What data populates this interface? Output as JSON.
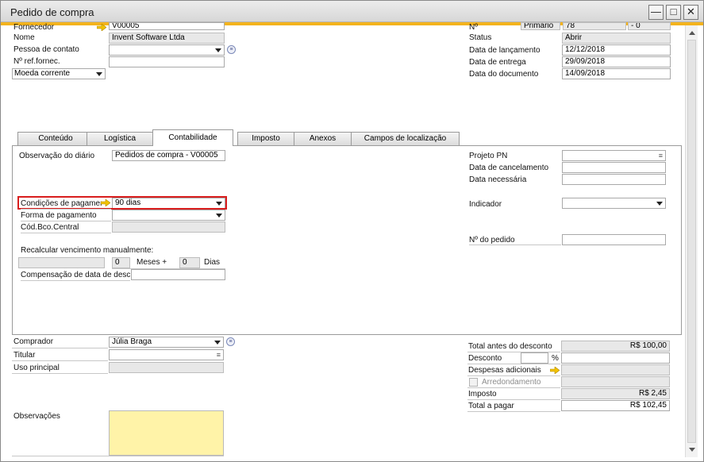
{
  "window": {
    "title": "Pedido de compra",
    "minimize_glyph": "—",
    "maximize_glyph": "□",
    "close_glyph": "✕"
  },
  "header_left": {
    "fornecedor_label": "Fornecedor",
    "fornecedor_value": "V00005",
    "nome_label": "Nome",
    "nome_value": "Invent Software Ltda",
    "pessoa_label": "Pessoa de contato",
    "pessoa_value": "",
    "ref_label": "Nº ref.fornec.",
    "ref_value": "",
    "moeda_label": "Moeda corrente"
  },
  "header_right": {
    "no_label": "Nº",
    "series_value": "Primário",
    "number_value": "78",
    "suffix_value": "0",
    "status_label": "Status",
    "status_value": "Abrir",
    "lanc_label": "Data de lançamento",
    "lanc_value": "12/12/2018",
    "entrega_label": "Data de entrega",
    "entrega_value": "29/09/2018",
    "doc_label": "Data do documento",
    "doc_value": "14/09/2018"
  },
  "tabs": [
    {
      "label": "Conteúdo"
    },
    {
      "label": "Logística"
    },
    {
      "label": "Contabilidade"
    },
    {
      "label": "Imposto"
    },
    {
      "label": "Anexos"
    },
    {
      "label": "Campos de localização"
    }
  ],
  "accounting": {
    "obs_diario_label": "Observação do diário",
    "obs_diario_value": "Pedidos de compra - V00005",
    "cond_pag_label": "Condições de pagamento",
    "cond_pag_value": "90 dias",
    "forma_pag_label": "Forma de pagamento",
    "forma_pag_value": "",
    "cod_bco_label": "Cód.Bco.Central",
    "recalc_label": "Recalcular vencimento manualmente:",
    "meses_value": "0",
    "meses_label": "Meses +",
    "dias_value": "0",
    "dias_label": "Dias",
    "comp_label": "Compensação de data de desconto",
    "projeto_label": "Projeto PN",
    "cancel_label": "Data de cancelamento",
    "necessaria_label": "Data necessária",
    "indicador_label": "Indicador",
    "pedido_label": "Nº do pedido"
  },
  "footer_left": {
    "comprador_label": "Comprador",
    "comprador_value": "Júlia Braga",
    "titular_label": "Titular",
    "uso_label": "Uso principal",
    "obs_label": "Observações"
  },
  "totals": {
    "antes_label": "Total antes do desconto",
    "antes_value": "R$ 100,00",
    "desconto_label": "Desconto",
    "percent_label": "%",
    "despesas_label": "Despesas adicionais",
    "arred_label": "Arredondamento",
    "imposto_label": "Imposto",
    "imposto_value": "R$ 2,45",
    "total_label": "Total a pagar",
    "total_value": "R$ 102,45"
  },
  "colors": {
    "accent": "#f3b31d",
    "highlight": "#d91e1e",
    "notes_bg": "#fff3a8"
  }
}
